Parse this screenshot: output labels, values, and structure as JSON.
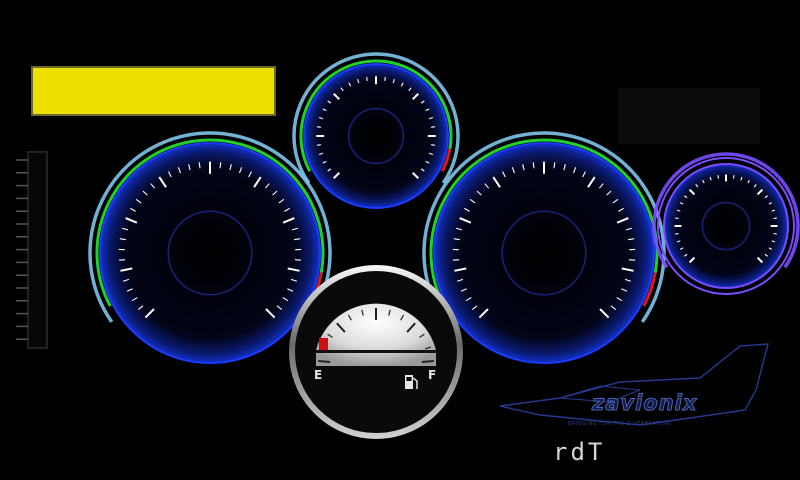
{
  "colors": {
    "background": "#000000",
    "yellow_panel": "#eee000",
    "gauge_ring_blue": "#1a3cff",
    "arc_outer": "#7ec4ea",
    "arc_green": "#22d02a",
    "arc_red": "#e01818",
    "small_gauge_purple": "#7a4cff",
    "fuel_marker": "#d01010"
  },
  "fuel_gauge": {
    "empty_label": "E",
    "full_label": "F",
    "icon": "fuel-pump-icon"
  },
  "branding": {
    "logo_text": "zavionix",
    "tagline": "BRIDGING FOR THE Z GENERATION",
    "maker_text": "rdT",
    "logo_icon": "fighter-jet-icon"
  }
}
